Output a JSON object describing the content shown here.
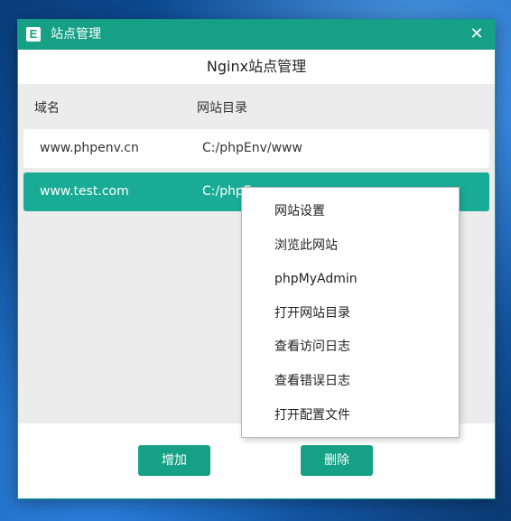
{
  "window": {
    "title": "站点管理",
    "app_icon_letter": "E",
    "close_symbol": "✕",
    "header_title": "Nginx站点管理"
  },
  "table": {
    "columns": [
      "域名",
      "网站目录"
    ],
    "rows": [
      {
        "domain": "www.phpenv.cn",
        "directory": "C:/phpEnv/www",
        "selected": false
      },
      {
        "domain": "www.test.com",
        "directory": "C:/phpE",
        "selected": true
      }
    ]
  },
  "buttons": {
    "add_label": "增加",
    "delete_label": "删除"
  },
  "context_menu": {
    "items": [
      "网站设置",
      "浏览此网站",
      "phpMyAdmin",
      "打开网站目录",
      "查看访问日志",
      "查看错误日志",
      "打开配置文件"
    ]
  },
  "colors": {
    "accent": "#16a085",
    "selected_row": "#1aab96"
  }
}
